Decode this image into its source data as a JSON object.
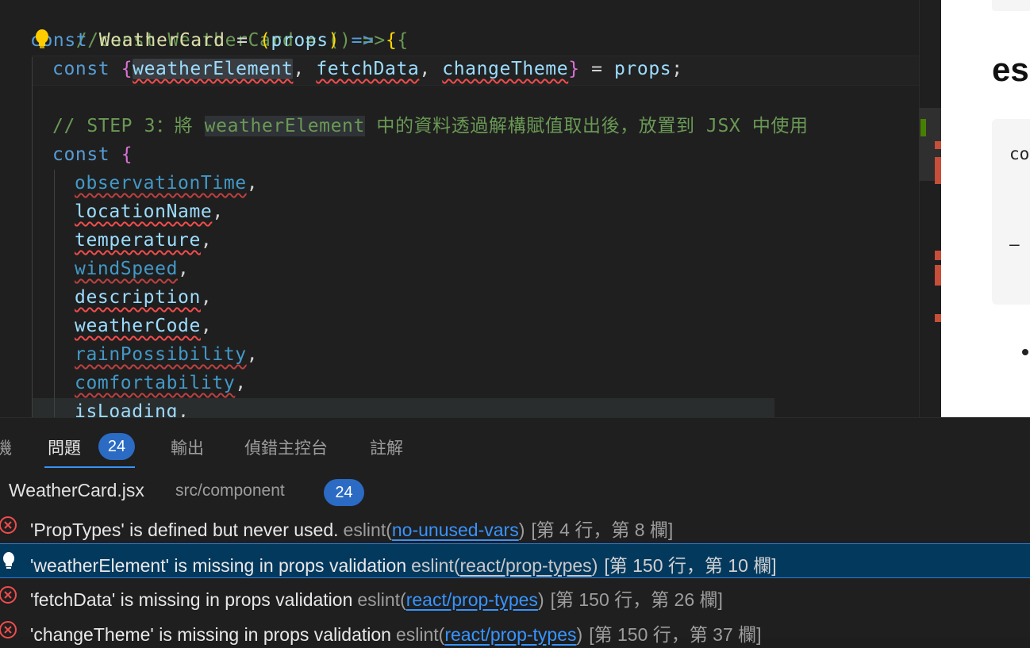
{
  "editor": {
    "lines": {
      "l1": "//const WeatherCard = () => {",
      "l2_kw": "const",
      "l2_name": "WeatherCard",
      "l2_eq": " = ",
      "l2_props": "props",
      "l2_arrow": "=>",
      "l3_kw": "const",
      "l3_v1": "weatherElement",
      "l3_v2": "fetchData",
      "l3_v3": "changeTheme",
      "l3_props": "props",
      "l5_a": "// STEP 3：將 ",
      "l5_box": "weatherElement",
      "l5_b": " 中的資料透過解構賦值取出後，放置到 JSX 中使用",
      "l6_kw": "const"
    },
    "destructured": [
      {
        "name": "observationTime",
        "dim": true
      },
      {
        "name": "locationName",
        "dim": false
      },
      {
        "name": "temperature",
        "dim": false
      },
      {
        "name": "windSpeed",
        "dim": true
      },
      {
        "name": "description",
        "dim": false
      },
      {
        "name": "weatherCode",
        "dim": false
      },
      {
        "name": "rainPossibility",
        "dim": true
      },
      {
        "name": "comfortability",
        "dim": true
      },
      {
        "name": "isLoading",
        "dim": false
      }
    ]
  },
  "preview": {
    "heading": "es",
    "code1": "co",
    "code2": "–"
  },
  "panel": {
    "tabs": {
      "partial": "機",
      "problems": "問題",
      "problems_count": "24",
      "output": "輸出",
      "debug_console": "偵錯主控台",
      "comments": "註解"
    },
    "file": {
      "name": "WeatherCard.jsx",
      "path": "src/component",
      "count": "24"
    },
    "problems": [
      {
        "msg": "'PropTypes' is defined but never used.",
        "src": "eslint(",
        "rule": "no-unused-vars",
        "close": ")",
        "loc": "[第 4 行，第 8 欄]"
      },
      {
        "msg": "'weatherElement' is missing in props validation",
        "src": "eslint(",
        "rule": "react/prop-types",
        "close": ")",
        "loc": "[第 150 行，第 10 欄]"
      },
      {
        "msg": "'fetchData' is missing in props validation",
        "src": "eslint(",
        "rule": "react/prop-types",
        "close": ")",
        "loc": "[第 150 行，第 26 欄]"
      },
      {
        "msg": "'changeTheme' is missing in props validation",
        "src": "eslint(",
        "rule": "react/prop-types",
        "close": ")",
        "loc": "[第 150 行，第 37 欄]"
      }
    ]
  },
  "colors": {
    "accent": "#3794ff",
    "badge": "#2b6bc4",
    "error": "#f14c4c",
    "selected_row": "#04395e"
  },
  "icons": {
    "problem_error": "error-circle-icon",
    "problem_selected": "lightbulb-icon",
    "editor_hint": "lightbulb-icon"
  }
}
